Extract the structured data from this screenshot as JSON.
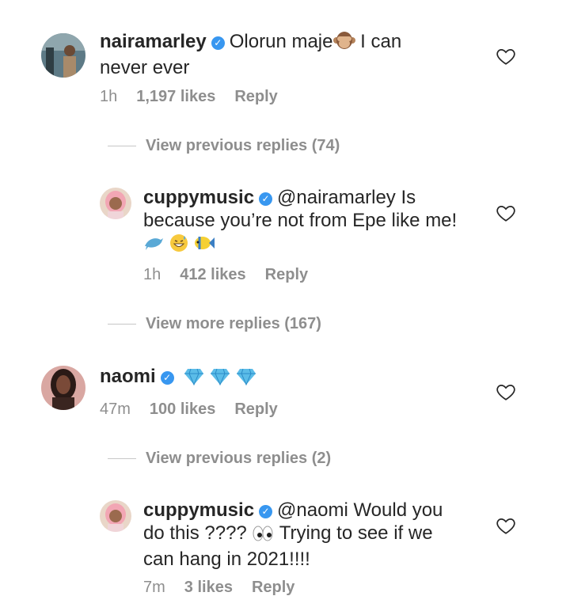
{
  "comments": [
    {
      "username": "nairamarley",
      "text_before": "Olorun maje",
      "text_after": " I can never ever",
      "time": "1h",
      "likes": "1,197 likes",
      "reply_label": "Reply"
    },
    {
      "username": "cuppymusic",
      "text": "@nairamarley Is because you’re not from Epe like me!",
      "time": "1h",
      "likes": "412 likes",
      "reply_label": "Reply"
    },
    {
      "username": "naomi",
      "time": "47m",
      "likes": "100 likes",
      "reply_label": "Reply"
    },
    {
      "username": "cuppymusic",
      "text_before": "@naomi Would you do this ????",
      "text_after": " Trying to see if we can hang in 2021!!!!",
      "time": "7m",
      "likes": "3 likes",
      "reply_label": "Reply"
    }
  ],
  "view_replies": [
    "View previous replies (74)",
    "View more replies (167)",
    "View previous replies (2)"
  ],
  "icons": {
    "verified": "verified-badge-icon",
    "heart": "heart-outline-icon"
  },
  "colors": {
    "verified": "#3897f0",
    "muted": "#8e8e8e",
    "text": "#262626"
  }
}
